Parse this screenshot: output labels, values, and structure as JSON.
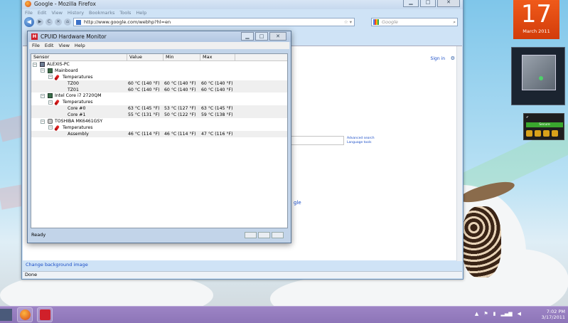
{
  "firefox": {
    "title": "Google - Mozilla Firefox",
    "menu": [
      "File",
      "Edit",
      "View",
      "History",
      "Bookmarks",
      "Tools",
      "Help"
    ],
    "url": "http://www.google.com/webhp?hl=en",
    "search_placeholder": "Google",
    "status": "Done",
    "page": {
      "sign_in": "Sign in",
      "advanced_search": "Advanced search",
      "language_tools": "Language tools",
      "partial_logo_text": "gle",
      "change_background": "Change background image"
    }
  },
  "hwmonitor": {
    "title": "CPUID Hardware Monitor",
    "menu": [
      "File",
      "Edit",
      "View",
      "Help"
    ],
    "columns": [
      "Sensor",
      "Value",
      "Min",
      "Max"
    ],
    "rows": [
      {
        "name": "ALEXIS-PC",
        "level": 0,
        "icon": "pc-icon",
        "value": "",
        "min": "",
        "max": ""
      },
      {
        "name": "Mainboard",
        "level": 1,
        "icon": "mainboard-icon",
        "value": "",
        "min": "",
        "max": ""
      },
      {
        "name": "Temperatures",
        "level": 2,
        "icon": "thermometer-icon",
        "value": "",
        "min": "",
        "max": ""
      },
      {
        "name": "TZ00",
        "level": 3,
        "icon": "",
        "value": "60 °C (140 °F)",
        "min": "60 °C (140 °F)",
        "max": "60 °C (140 °F)"
      },
      {
        "name": "TZ01",
        "level": 3,
        "icon": "",
        "value": "60 °C (140 °F)",
        "min": "60 °C (140 °F)",
        "max": "60 °C (140 °F)"
      },
      {
        "name": "Intel Core i7 2720QM",
        "level": 1,
        "icon": "cpu-icon",
        "value": "",
        "min": "",
        "max": ""
      },
      {
        "name": "Temperatures",
        "level": 2,
        "icon": "thermometer-icon",
        "value": "",
        "min": "",
        "max": ""
      },
      {
        "name": "Core #0",
        "level": 3,
        "icon": "",
        "value": "63 °C (145 °F)",
        "min": "53 °C (127 °F)",
        "max": "63 °C (145 °F)"
      },
      {
        "name": "Core #1",
        "level": 3,
        "icon": "",
        "value": "55 °C (131 °F)",
        "min": "50 °C (122 °F)",
        "max": "59 °C (138 °F)"
      },
      {
        "name": "TOSHIBA MK6461GSY",
        "level": 1,
        "icon": "harddisk-icon",
        "value": "",
        "min": "",
        "max": ""
      },
      {
        "name": "Temperatures",
        "level": 2,
        "icon": "thermometer-icon",
        "value": "",
        "min": "",
        "max": ""
      },
      {
        "name": "Assembly",
        "level": 3,
        "icon": "",
        "value": "46 °C (114 °F)",
        "min": "46 °C (114 °F)",
        "max": "47 °C (116 °F)"
      }
    ],
    "status": "Ready"
  },
  "calendar": {
    "day": "17",
    "month": "March 2011"
  },
  "norton": {
    "status": "Secure"
  },
  "taskbar": {
    "time": "7:02 PM",
    "date": "3/17/2011"
  }
}
